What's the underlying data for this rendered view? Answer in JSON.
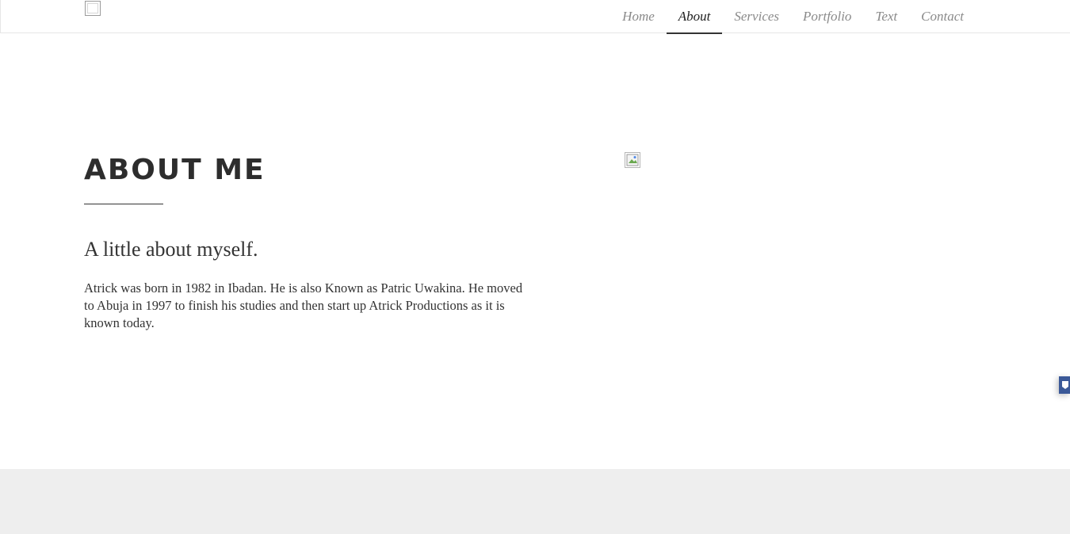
{
  "nav": {
    "items": [
      {
        "label": "Home",
        "active": false
      },
      {
        "label": "About",
        "active": true
      },
      {
        "label": "Services",
        "active": false
      },
      {
        "label": "Portfolio",
        "active": false
      },
      {
        "label": "Text",
        "active": false
      },
      {
        "label": "Contact",
        "active": false
      }
    ]
  },
  "about": {
    "title": "ABOUT ME",
    "subtitle": "A little about myself.",
    "body": "Atrick was born in 1982 in Ibadan. He is also Known as Patric Uwakina. He moved to Abuja in 1997 to finish his studies and then start up Atrick Productions as it is known today."
  },
  "colors": {
    "text": "#333333",
    "nav_inactive": "#8a8a8a",
    "nav_active": "#222222",
    "footer_band": "#eeeeee",
    "side_widget": "#3b5998"
  },
  "icons": {
    "logo": "broken-image-icon",
    "about_image": "broken-image-icon",
    "side_widget": "share-icon"
  }
}
